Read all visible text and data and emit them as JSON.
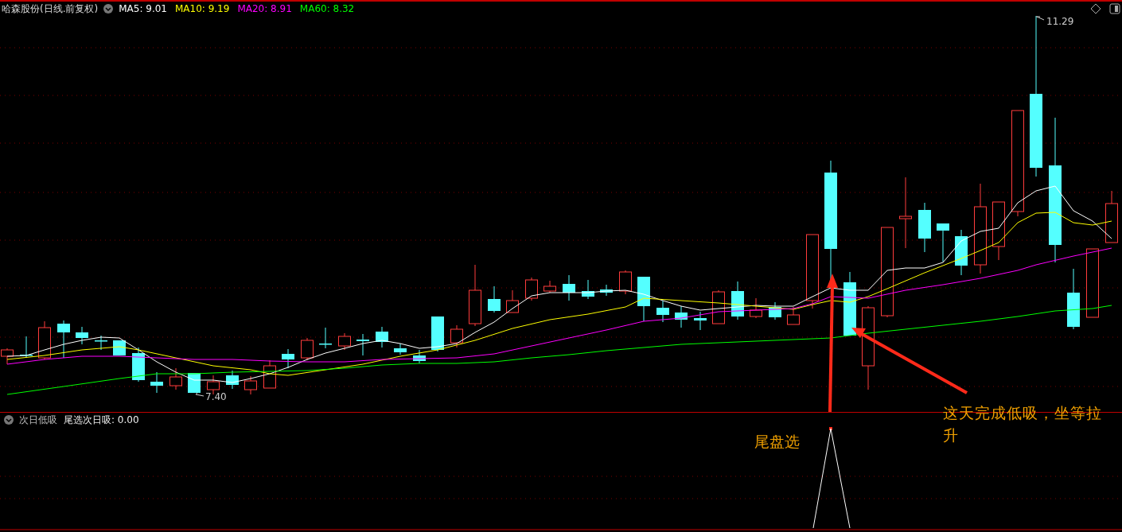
{
  "chart_header": {
    "title": "哈森股份(日线.前复权)",
    "moving_averages": [
      {
        "label": "MA5: 9.01",
        "color": "#ffffff"
      },
      {
        "label": "MA10: 9.19",
        "color": "#ffff00"
      },
      {
        "label": "MA20: 8.91",
        "color": "#ff00ff"
      },
      {
        "label": "MA60: 8.32",
        "color": "#00ff00"
      }
    ]
  },
  "price_labels": {
    "high": "11.29",
    "low": "7.40"
  },
  "indicator_header": {
    "title": "次日低吸",
    "reading": "尾选次日吸: 0.00"
  },
  "annotations": [
    {
      "text": "尾盘选"
    },
    {
      "text": "这天完成低吸，坐等拉升"
    }
  ]
}
